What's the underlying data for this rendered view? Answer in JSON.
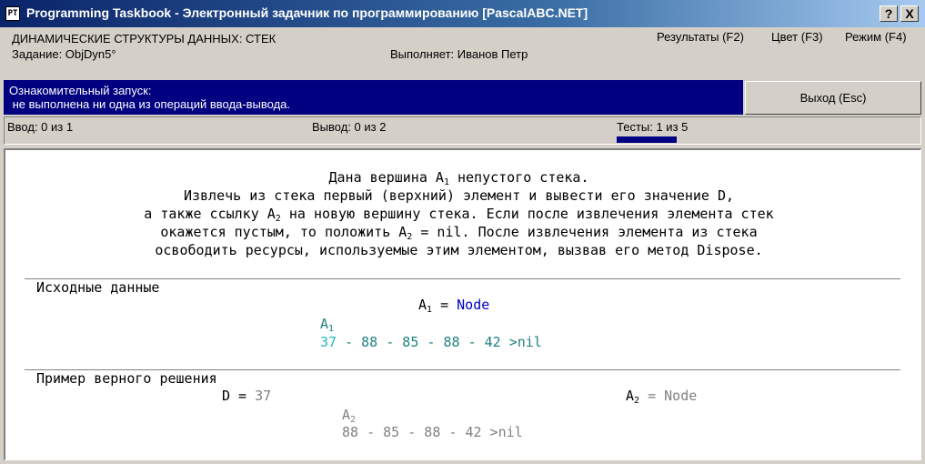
{
  "window": {
    "icon_text": "PT",
    "title": "Programming Taskbook - Электронный задачник по программированию [PascalABC.NET]",
    "help_label": "?",
    "close_label": "X"
  },
  "header": {
    "group": "ДИНАМИЧЕСКИЕ СТРУКТУРЫ ДАННЫХ: СТЕК",
    "task": "Задание: ObjDyn5°",
    "performer": "Выполняет: Иванов Петр",
    "menu": {
      "results": "Результаты (F2)",
      "color": "Цвет (F3)",
      "mode": "Режим (F4)"
    }
  },
  "banner": {
    "line1": "Ознакомительный запуск:",
    "line2": " не выполнена ни одна из операций ввода-вывода.",
    "exit_label": "Выход (Esc)"
  },
  "status": {
    "input": "Ввод: 0 из 1",
    "output": "Вывод: 0 из 2",
    "tests": "Тесты: 1 из 5",
    "tests_progress": 0.2
  },
  "task_text": {
    "l1_a": "Дана вершина A",
    "l1_sub": "1",
    "l1_b": " непустого стека.",
    "l2": "Извлечь из стека первый (верхний) элемент и вывести его значение D,",
    "l3_a": "а также ссылку A",
    "l3_sub": "2",
    "l3_b": " на новую вершину стека. Если после извлечения элемента стек",
    "l4_a": "окажется пустым, то положить A",
    "l4_sub": "2",
    "l4_b": " = nil. После извлечения элемента из стека",
    "l5": "освободить ресурсы, используемые этим элементом, вызвав его метод Dispose."
  },
  "input_section": {
    "heading": "Исходные данные",
    "a1_label": "A",
    "a1_sub": "1",
    "a1_eq": " = ",
    "a1_value": "Node",
    "ptr_label": "A",
    "ptr_sub": "1",
    "stack_first": "37",
    "stack_rest": " - 88 - 85 - 88 - 42 >nil"
  },
  "example_section": {
    "heading": "Пример верного решения",
    "d_label": "D = ",
    "d_value": "37",
    "a2_label": "A",
    "a2_sub": "2",
    "a2_eq": " = Node",
    "ptr_label": "A",
    "ptr_sub": "2",
    "stack": "88 - 85 - 88 - 42 >nil"
  },
  "colors": {
    "title_bar": "#0a246a",
    "banner": "#000080",
    "node_blue": "#0000c8",
    "pointer_teal": "#208080",
    "value_cyan": "#28b8b8",
    "example_gray": "#808080"
  }
}
